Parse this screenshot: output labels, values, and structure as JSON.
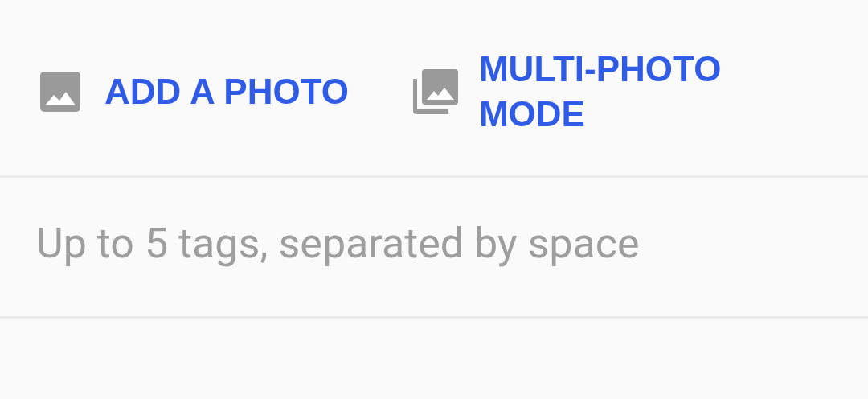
{
  "actions": [
    {
      "kind": "single",
      "label": "ADD A PHOTO"
    },
    {
      "kind": "multi",
      "label": "MULTI-PHOTO MODE"
    }
  ],
  "tags_field": {
    "placeholder": "Up to 5 tags, separated by space"
  }
}
